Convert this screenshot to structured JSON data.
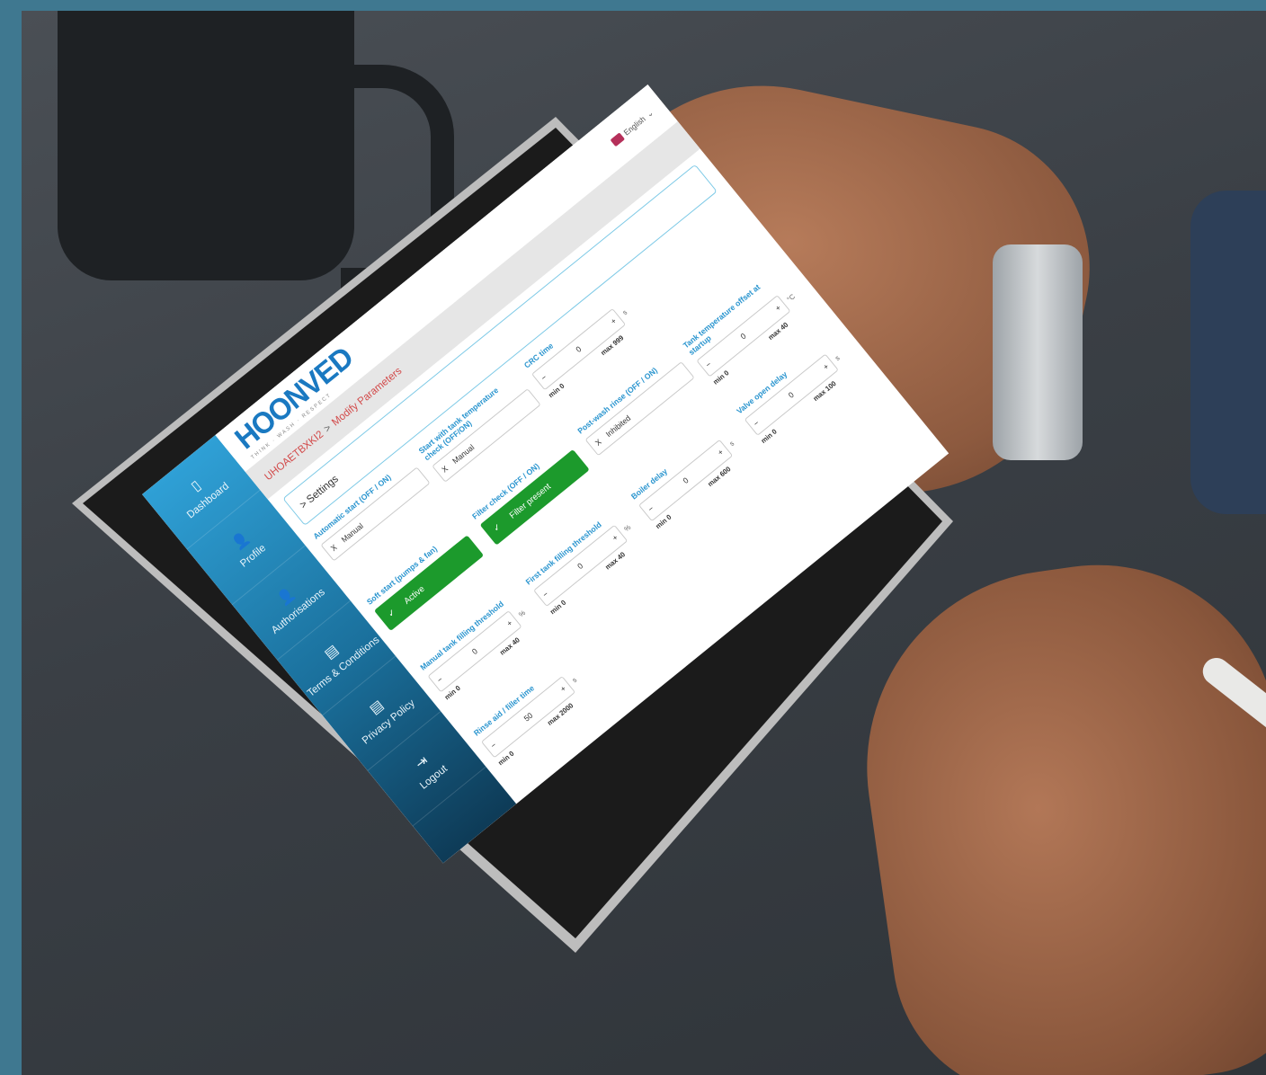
{
  "brand": {
    "logo_text": "HOONVED",
    "logo_tagline": "THINK · WASH · RESPECT"
  },
  "header": {
    "language": "English",
    "chevron": "⌄"
  },
  "sidebar": {
    "items": [
      {
        "label": "Dashboard",
        "icon": "tablet-icon",
        "glyph": "▯"
      },
      {
        "label": "Profile",
        "icon": "user-icon",
        "glyph": "👤"
      },
      {
        "label": "Authorisations",
        "icon": "user-shield-icon",
        "glyph": "👤"
      },
      {
        "label": "Terms & Conditions",
        "icon": "document-icon",
        "glyph": "▤"
      },
      {
        "label": "Privacy Policy",
        "icon": "document-icon",
        "glyph": "▤"
      },
      {
        "label": "Logout",
        "icon": "logout-icon",
        "glyph": "⇥"
      }
    ]
  },
  "breadcrumb": {
    "parent": "UHOAETBXKI2",
    "separator": ">",
    "current": "Modify Parameters"
  },
  "settings_panel": {
    "label": "> Settings"
  },
  "fields": [
    {
      "label": "Automatic start (OFF / ON)",
      "kind": "select",
      "value": "Manual",
      "prefix": "X"
    },
    {
      "label": "Start with tank temperature check (OFF/ON)",
      "kind": "select",
      "value": "Manual",
      "prefix": "X"
    },
    {
      "label": "CRC time",
      "kind": "number",
      "value": "0",
      "unit": "s",
      "min": "min 0",
      "max": "max 999"
    },
    {
      "label": "",
      "kind": "empty"
    },
    {
      "label": "Soft start (pumps & fan)",
      "kind": "toggle",
      "value": "Active"
    },
    {
      "label": "Filter check (OFF / ON)",
      "kind": "toggle",
      "value": "Filter present"
    },
    {
      "label": "Post-wash rinse (OFF / ON)",
      "kind": "select",
      "value": "Inhibited",
      "prefix": "X"
    },
    {
      "label": "Tank temperature offset at startup",
      "kind": "number",
      "value": "0",
      "unit": "°C",
      "min": "min 0",
      "max": "max 40"
    },
    {
      "label": "Manual tank filling threshold",
      "kind": "number",
      "value": "0",
      "unit": "%",
      "min": "min 0",
      "max": "max 40"
    },
    {
      "label": "First tank filling threshold",
      "kind": "number",
      "value": "0",
      "unit": "%",
      "min": "min 0",
      "max": "max 40"
    },
    {
      "label": "Boiler delay",
      "kind": "number",
      "value": "0",
      "unit": "s",
      "min": "min 0",
      "max": "max 600"
    },
    {
      "label": "Valve open delay",
      "kind": "number",
      "value": "0",
      "unit": "s",
      "min": "min 0",
      "max": "max 100"
    },
    {
      "label": "Rinse aid / filler time",
      "kind": "number",
      "value": "50",
      "unit": "s",
      "min": "min 0",
      "max": "max 2000"
    }
  ],
  "colors": {
    "frame": "#3f7890",
    "accent": "#2a95cf",
    "toggle_on": "#1c9a2c",
    "breadcrumb_current": "#d24a4a"
  }
}
